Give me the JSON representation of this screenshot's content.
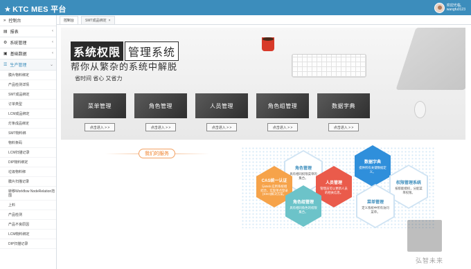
{
  "app": {
    "title": "KTC MES 平台"
  },
  "user": {
    "greeting": "欢迎光临,",
    "name": "wangfu0123"
  },
  "sidebar": {
    "console": "控制台",
    "menus": [
      {
        "label": "报表"
      },
      {
        "label": "系统管理"
      },
      {
        "label": "基础数据"
      },
      {
        "label": "生产管理"
      }
    ],
    "sub_items": [
      "膜片物料绑定",
      "产品检测详情",
      "SMT成品绑定",
      "订单类型",
      "LCM成品绑定",
      "灯条成品绑定",
      "SMT物料绑",
      "物料条码",
      "LCM扫描记录",
      "DIP物料绑定",
      "垃圾物料绑",
      "膜片扫描记录",
      "转移Workflow NodeRelation范围",
      "上料",
      "产品检测",
      "产品不良原因",
      "LCM物料绑定",
      "DIP扫描记录"
    ]
  },
  "tabs": [
    {
      "label": "控制台"
    },
    {
      "label": "SMT成品绑定"
    }
  ],
  "banner": {
    "title_part1": "系统权限",
    "title_part2": "管理系统",
    "subtitle": "帮你从繁杂的系统中解脱",
    "slogan": "省时间 省心 又省力",
    "cards": [
      {
        "label": "菜单管理",
        "button": "点击进入 > >"
      },
      {
        "label": "角色管理",
        "button": "点击进入 > >"
      },
      {
        "label": "人员管理",
        "button": "点击进入 > >"
      },
      {
        "label": "角色组管理",
        "button": "点击进入 > >"
      },
      {
        "label": "数据字典",
        "button": "点击进入 > >"
      }
    ]
  },
  "services": {
    "title": "我们的服务",
    "items": [
      {
        "heading": "角色管理",
        "desc": "具有相同权限菜单的集合。"
      },
      {
        "heading": "数据字典",
        "desc": "提供所有关键数据定义。"
      },
      {
        "heading": "CAS统一认证",
        "desc": "与Web 应用系统相结合，实现单点登录(SSO)解决方案。"
      },
      {
        "heading": "人员管理",
        "desc": "管理员可以更新人员的相关信息。"
      },
      {
        "heading": "权限管理系统",
        "desc": "按职能授权，分配菜单权限。"
      },
      {
        "heading": "角色组管理",
        "desc": "具有相同角色的权限集合。"
      },
      {
        "heading": "菜单管理",
        "desc": "定义系统中所有访问菜单。"
      }
    ]
  },
  "watermark": {
    "text": "弘智未来"
  },
  "colors": {
    "header": "#3c8dbc",
    "accent_orange": "#ef7f28"
  }
}
